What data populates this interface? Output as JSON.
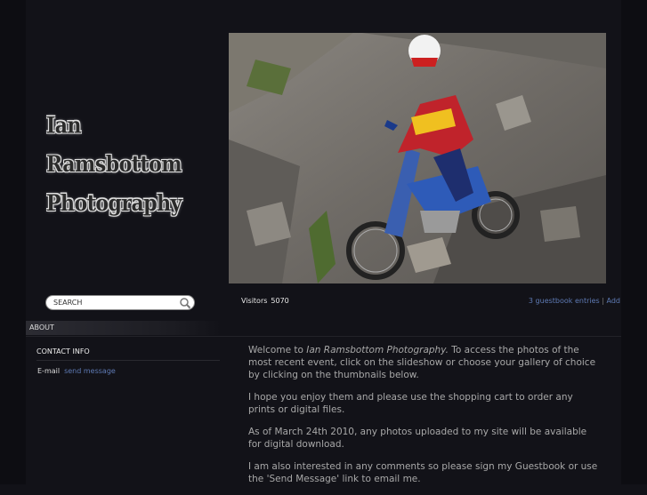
{
  "logo": {
    "line1": "Ian Ramsbottom",
    "line2": "Photography"
  },
  "search": {
    "placeholder": "SEARCH",
    "icon": "magnifier-icon"
  },
  "visitors": {
    "label": "Visitors",
    "count": "5070"
  },
  "guestbook": {
    "entries_link": "3 guestbook entries",
    "separator": "|",
    "add_link": "Add"
  },
  "sidebar": {
    "section_title": "ABOUT",
    "contact_title": "CONTACT INFO",
    "email_label": "E-mail",
    "email_link": "send message"
  },
  "welcome": {
    "p1_pre": "Welcome to ",
    "p1_site": "Ian Ramsbottom Photography.",
    "p1_post": " To access the photos of the most recent event, click on the slideshow or choose your gallery of choice by clicking on the thumbnails below.",
    "p2": "I hope you enjoy them and please use the shopping cart to order any prints or digital files.",
    "p3": "As of March 24th 2010, any photos uploaded to my site will be available for digital download.",
    "p4": "I am also interested in any comments so please sign my Guestbook or use the 'Send Message' link to email me."
  },
  "colors": {
    "background": "#121218",
    "link": "#5e7ab4",
    "text": "#a8a8a8"
  }
}
